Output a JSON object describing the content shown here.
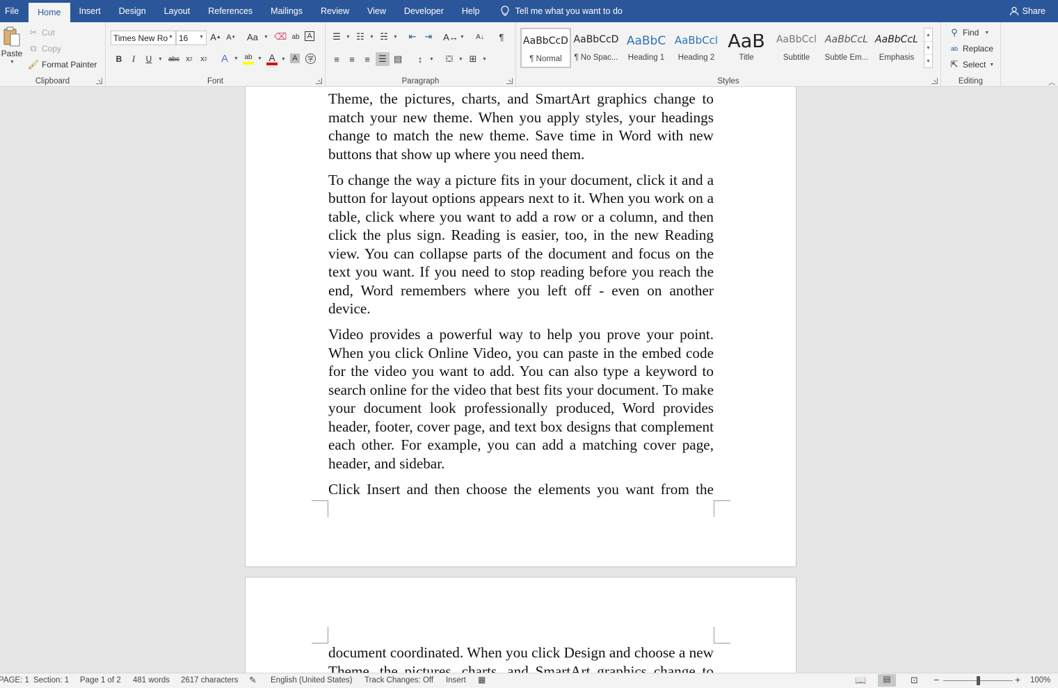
{
  "tabs": {
    "file": "File",
    "home": "Home",
    "insert": "Insert",
    "design": "Design",
    "layout": "Layout",
    "references": "References",
    "mailings": "Mailings",
    "review": "Review",
    "view": "View",
    "developer": "Developer",
    "help": "Help",
    "tell_me": "Tell me what you want to do",
    "share": "Share"
  },
  "clipboard": {
    "label": "Clipboard",
    "paste": "Paste",
    "cut": "Cut",
    "copy": "Copy",
    "format_painter": "Format Painter"
  },
  "font": {
    "label": "Font",
    "name": "Times New Ro",
    "size": "16"
  },
  "paragraph": {
    "label": "Paragraph"
  },
  "styles": {
    "label": "Styles",
    "items": [
      {
        "preview": "AaBbCcD",
        "name": "¶ Normal"
      },
      {
        "preview": "AaBbCcD",
        "name": "¶ No Spac..."
      },
      {
        "preview": "AaBbC",
        "name": "Heading 1"
      },
      {
        "preview": "AaBbCcl",
        "name": "Heading 2"
      },
      {
        "preview": "AaB",
        "name": "Title"
      },
      {
        "preview": "AaBbCcl",
        "name": "Subtitle"
      },
      {
        "preview": "AaBbCcL",
        "name": "Subtle Em..."
      },
      {
        "preview": "AaBbCcL",
        "name": "Emphasis"
      }
    ]
  },
  "editing": {
    "label": "Editing",
    "find": "Find",
    "replace": "Replace",
    "select": "Select"
  },
  "document": {
    "page1_paragraphs": [
      "Theme, the pictures, charts, and SmartArt graphics change to match your new theme. When you apply styles, your headings change to match the new theme. Save time in Word with new buttons that show up where you need them.",
      "To change the way a picture fits in your document, click it and a button for layout options appears next to it. When you work on a table, click where you want to add a row or a column, and then click the plus sign. Reading is easier, too, in the new Reading view. You can collapse parts of the document and focus on the text you want. If you need to stop reading before you reach the end, Word remembers where you left off - even on another device.",
      "Video provides a powerful way to help you prove your point. When you click Online Video, you can paste in the embed code for the video you want to add. You can also type a keyword to search online for the video that best fits your document. To make your document look professionally produced, Word provides header, footer, cover page, and text box designs that complement each other. For example, you can add a matching cover page, header, and sidebar.",
      "Click Insert and then choose the elements you want from the different galleries. Themes and styles also help keep your"
    ],
    "page2_line1": "document coordinated. When you click Design and choose a new",
    "page2_line2": "Theme, the pictures, charts, and SmartArt graphics change to"
  },
  "status": {
    "page": "PAGE: 1",
    "section": "Section: 1",
    "page_of": "Page 1 of 2",
    "words": "481 words",
    "characters": "2617 characters",
    "language": "English (United States)",
    "track_changes": "Track Changes: Off",
    "insert_mode": "Insert",
    "zoom_minus": "−",
    "zoom_plus": "+",
    "zoom": "100%",
    "zoom_level_percent": 100
  },
  "colors": {
    "accent": "#2b579a",
    "ribbon_bg": "#f3f3f3",
    "canvas_bg": "#e6e6e6",
    "font_color_bar": "#e00000",
    "highlight_bar": "#ffff00"
  }
}
